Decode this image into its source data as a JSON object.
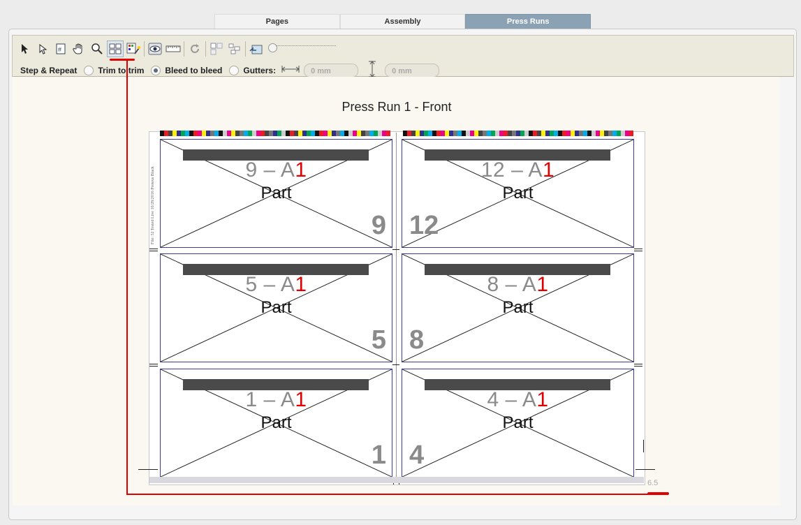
{
  "tabs": [
    {
      "label": "Pages",
      "active": false
    },
    {
      "label": "Assembly",
      "active": false
    },
    {
      "label": "Press Runs",
      "active": true
    }
  ],
  "toolbar": {
    "tools": [
      "arrow-pointer-icon",
      "direct-select-icon",
      "page-number-icon",
      "hand-icon",
      "zoom-icon",
      "step-repeat-grid-icon",
      "layout-wizard-icon",
      "preview-eye-icon",
      "ruler-icon",
      "rotate-icon",
      "align-grid-icon",
      "distribute-icon",
      "fit-view-icon"
    ],
    "zoom_level": 0
  },
  "options": {
    "step_repeat_label": "Step & Repeat",
    "trim_label": "Trim to trim",
    "bleed_label": "Bleed to bleed",
    "gutters_label": "Gutters:",
    "selected_mode": "bleed",
    "gutter_h_placeholder": "0 mm",
    "gutter_v_placeholder": "0 mm"
  },
  "press_run": {
    "title": "Press Run 1 - Front",
    "slugline": "File: 52 Tested Live 10/28/2016 Proteus Black",
    "cells": [
      {
        "label_prefix": "9 – A",
        "label_suffix": "1",
        "part": "Part",
        "number": "9"
      },
      {
        "label_prefix": "12 – A",
        "label_suffix": "1",
        "part": "Part",
        "number": "12"
      },
      {
        "label_prefix": "5 – A",
        "label_suffix": "1",
        "part": "Part",
        "number": "5"
      },
      {
        "label_prefix": "8 – A",
        "label_suffix": "1",
        "part": "Part",
        "number": "8"
      },
      {
        "label_prefix": "1 – A",
        "label_suffix": "1",
        "part": "Part",
        "number": "1"
      },
      {
        "label_prefix": "4 – A",
        "label_suffix": "1",
        "part": "Part",
        "number": "4"
      }
    ],
    "coordinate_readout": "6.5"
  },
  "colors": {
    "accent_tab": "#8aa2b3",
    "annotation_red": "#e00000",
    "cell_border": "#3b3b9e"
  }
}
